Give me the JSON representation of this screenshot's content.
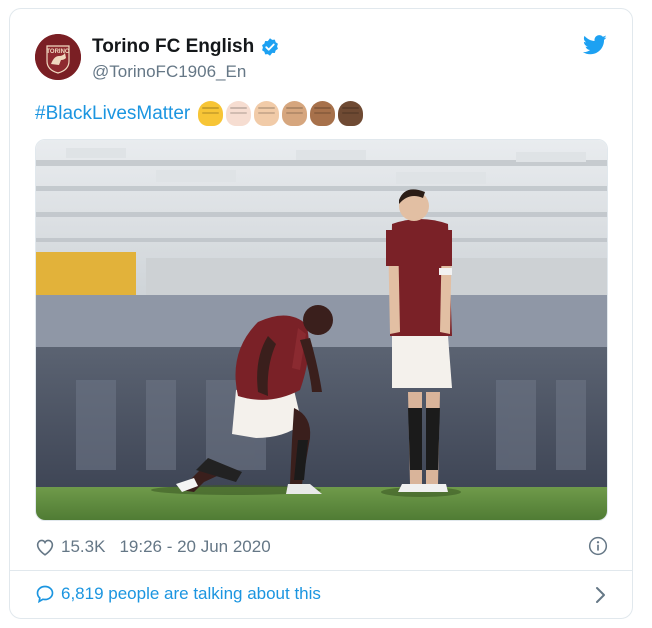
{
  "account": {
    "display_name": "Torino FC English",
    "handle": "@TorinoFC1906_En",
    "avatar_text": "TORINO",
    "verified": true
  },
  "tweet": {
    "hashtag": "#BlackLivesMatter",
    "emoji_skin_tones": [
      "#f7c536",
      "#f6ddd1",
      "#f1cba8",
      "#d6a67e",
      "#a7714b",
      "#6f4a33"
    ]
  },
  "stats": {
    "likes": "15.3K",
    "timestamp": "19:26 - 20 Jun 2020"
  },
  "footer": {
    "talking": "6,819 people are talking about this"
  },
  "colors": {
    "link": "#1b95e0",
    "muted": "#657786",
    "torino_maroon": "#7a1f24"
  },
  "icons": [
    "verified-badge-icon",
    "twitter-bird-icon",
    "heart-icon",
    "info-icon",
    "speech-bubble-icon",
    "chevron-right-icon"
  ]
}
